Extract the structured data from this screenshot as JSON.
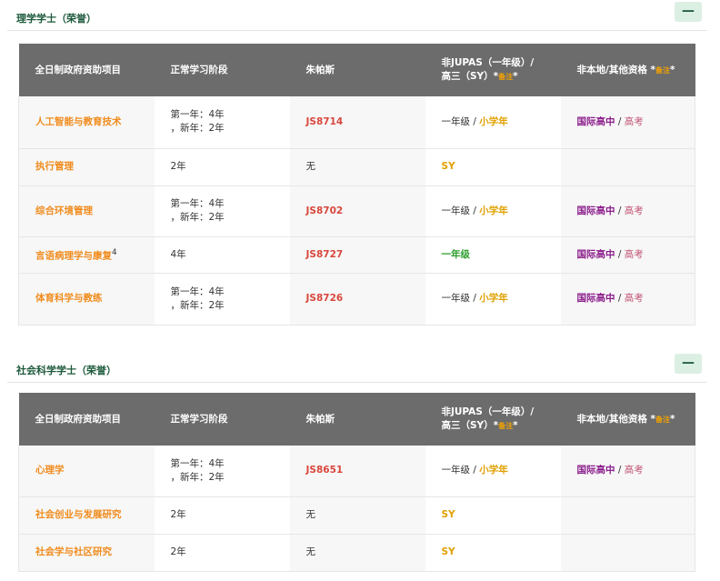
{
  "sections": [
    {
      "title": "理学学士（荣誉）",
      "collapse_label": "—",
      "headers": {
        "program": "全日制政府资助项目",
        "duration": "正常学习阶段",
        "jupas": "朱帕斯",
        "non_jupas_line1": "非JUPAS（一年级）/",
        "non_jupas_line2": "高三（SY）*",
        "non_jupas_note": "备注",
        "other_quals": "非本地/其他资格 *",
        "other_quals_note": "备注",
        "other_quals_star": "*"
      },
      "rows": [
        {
          "program": "人工智能与教育技术",
          "sup": "",
          "duration_line1": "第一年：4年",
          "duration_line2": "，新年：2年",
          "code": "JS8714",
          "year1": "一年级",
          "slash": " / ",
          "sy": "小学年",
          "ib": "国际高中",
          "gk": "高考"
        },
        {
          "program": "执行管理",
          "sup": "",
          "duration_line1": "2年",
          "duration_line2": "",
          "code": "无",
          "year1": "",
          "slash": "",
          "sy": "SY",
          "ib": "",
          "gk": ""
        },
        {
          "program": "综合环境管理",
          "sup": "",
          "duration_line1": "第一年：4年",
          "duration_line2": "，新年：2年",
          "code": "JS8702",
          "year1": "一年级",
          "slash": " / ",
          "sy": "小学年",
          "ib": "国际高中",
          "gk": "高考"
        },
        {
          "program": "言语病理学与康复",
          "sup": "4",
          "duration_line1": "4年",
          "duration_line2": "",
          "code": "JS8727",
          "year1": "一年级",
          "slash": "",
          "sy": "",
          "ib": "国际高中",
          "gk": "高考"
        },
        {
          "program": "体育科学与教练",
          "sup": "",
          "duration_line1": "第一年：4年",
          "duration_line2": "，新年：2年",
          "code": "JS8726",
          "year1": "一年级",
          "slash": " / ",
          "sy": "小学年",
          "ib": "国际高中",
          "gk": "高考"
        }
      ]
    },
    {
      "title": "社会科学学士（荣誉）",
      "collapse_label": "—",
      "headers": {
        "program": "全日制政府资助项目",
        "duration": "正常学习阶段",
        "jupas": "朱帕斯",
        "non_jupas_line1": "非JUPAS（一年级）/",
        "non_jupas_line2": "高三（SY）*",
        "non_jupas_note": "备注",
        "other_quals": "非本地/其他资格 *",
        "other_quals_note": "备注",
        "other_quals_star": "*"
      },
      "rows": [
        {
          "program": "心理学",
          "sup": "",
          "duration_line1": "第一年：4年",
          "duration_line2": "，新年：2年",
          "code": "JS8651",
          "year1": "一年级",
          "slash": " / ",
          "sy": "小学年",
          "ib": "国际高中",
          "gk": "高考"
        },
        {
          "program": "社会创业与发展研究",
          "sup": "",
          "duration_line1": "2年",
          "duration_line2": "",
          "code": "无",
          "year1": "",
          "slash": "",
          "sy": "SY",
          "ib": "",
          "gk": ""
        },
        {
          "program": "社会学与社区研究",
          "sup": "",
          "duration_line1": "2年",
          "duration_line2": "",
          "code": "无",
          "year1": "",
          "slash": "",
          "sy": "SY",
          "ib": "",
          "gk": ""
        }
      ]
    }
  ],
  "colors": {
    "header_bg": "#6c6c6c",
    "program_orange": "#f08c1e",
    "code_red": "#d9473d",
    "gold": "#e0a000",
    "green": "#2e9e2e",
    "purple": "#8b1d8b",
    "pink": "#c05070",
    "title_green": "#1d5a3b"
  }
}
